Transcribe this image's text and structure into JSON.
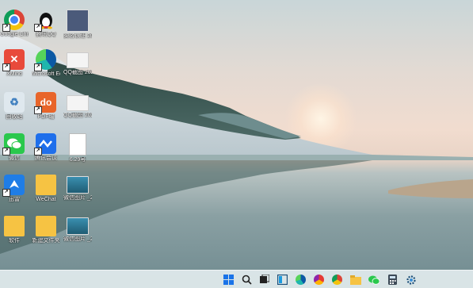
{
  "desktop_icons": [
    {
      "name": "chrome",
      "label": "Google Chrome",
      "glyph": ""
    },
    {
      "name": "qq",
      "label": "腾讯QQ",
      "glyph": ""
    },
    {
      "name": "file-top",
      "label": "实名认证 2021062...",
      "glyph": ""
    },
    {
      "name": "xmind",
      "label": "XMind",
      "glyph": "✕"
    },
    {
      "name": "edge",
      "label": "Microsoft Edge",
      "glyph": ""
    },
    {
      "name": "qq-screenshot-1",
      "label": "QQ截图 20210624...",
      "glyph": ""
    },
    {
      "name": "recycle-bin",
      "label": "回收站",
      "glyph": "♻"
    },
    {
      "name": "pdf",
      "label": "PDF编",
      "glyph": "do"
    },
    {
      "name": "qq-screenshot-2",
      "label": "QQ截图 20210620...",
      "glyph": ""
    },
    {
      "name": "wechat-app",
      "label": "微信",
      "glyph": ""
    },
    {
      "name": "tencent-meeting",
      "label": "腾讯会议",
      "glyph": ""
    },
    {
      "name": "doc-629",
      "label": "6.29号",
      "glyph": ""
    },
    {
      "name": "xunlei",
      "label": "迅雷",
      "glyph": ""
    },
    {
      "name": "wechat-folder",
      "label": "WeChat",
      "glyph": ""
    },
    {
      "name": "wechat-image-1",
      "label": "微信图片 _2021062...",
      "glyph": ""
    },
    {
      "name": "software-folder",
      "label": "软件",
      "glyph": ""
    },
    {
      "name": "new-folder",
      "label": "新建文件夹",
      "glyph": ""
    },
    {
      "name": "wechat-image-2",
      "label": "微信图片 _2021062...",
      "glyph": ""
    }
  ],
  "taskbar": {
    "items": [
      "start",
      "search",
      "task-view",
      "widgets",
      "edge",
      "chrome-like",
      "chrome",
      "file-explorer",
      "wechat",
      "calculator",
      "settings"
    ]
  }
}
